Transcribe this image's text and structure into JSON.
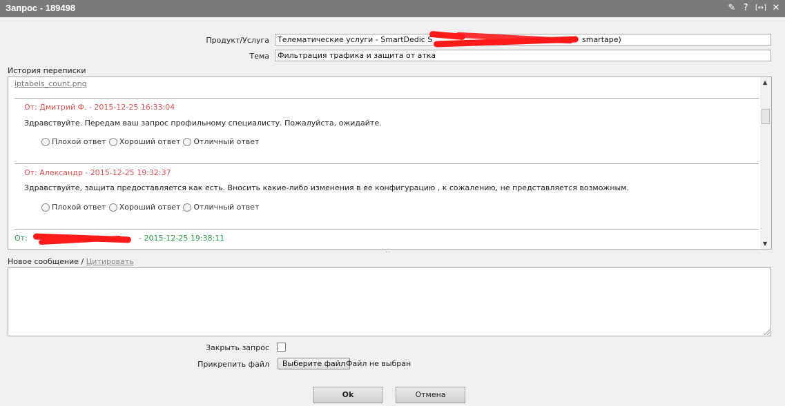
{
  "window": {
    "title": "Запрос - 189498",
    "icons": [
      "pin-icon",
      "help-icon",
      "resize-icon",
      "close-icon"
    ],
    "icon_glyphs": [
      "✎",
      "?",
      "[↔]",
      "✕"
    ]
  },
  "form": {
    "product_label": "Продукт/Услуга",
    "product_value_start": "Телематические услуги  - SmartDedic S",
    "product_value_end": "smartape)",
    "topic_label": "Тема",
    "topic_value": "Фильтрация трафика и защита от атка"
  },
  "history": {
    "label": "История переписки",
    "attachment": "iptabels_count.png",
    "messages": [
      {
        "header": "От: Дмитрий Ф. - 2015-12-25 16:33:04",
        "body": "Здравствуйте. Передам ваш запрос профильному специалисту. Пожалуйста, ожидайте.",
        "ratings": [
          "Плохой ответ",
          "Хороший ответ",
          "Отличный ответ"
        ]
      },
      {
        "header": "От: Александр - 2015-12-25 19:32:37",
        "body": "Здравствуйте, защита предоставляется как есть. Вносить какие-либо изменения в ее конфигурацию , к сожалению, не представляется возможным.",
        "ratings": [
          "Плохой ответ",
          "Хороший ответ",
          "Отличный ответ"
        ]
      }
    ],
    "last_header_prefix": "От:",
    "last_header_suffix": "- 2015-12-25 19:38:11"
  },
  "new_message": {
    "label": "Новое сообщение /",
    "cite_link": "Цитировать",
    "value": ""
  },
  "close_request": {
    "label": "Закрыть запрос",
    "checked": false
  },
  "attach_file": {
    "label": "Прикрепить файл",
    "button": "Выберите файл",
    "status": "Файл не выбран"
  },
  "buttons": {
    "ok": "Ok",
    "cancel": "Отмена"
  },
  "colors": {
    "titlebar": "#7b7b7b",
    "staff_header": "#d9534f",
    "user_header": "#2e9a4a",
    "redaction": "#ff1a1a"
  }
}
